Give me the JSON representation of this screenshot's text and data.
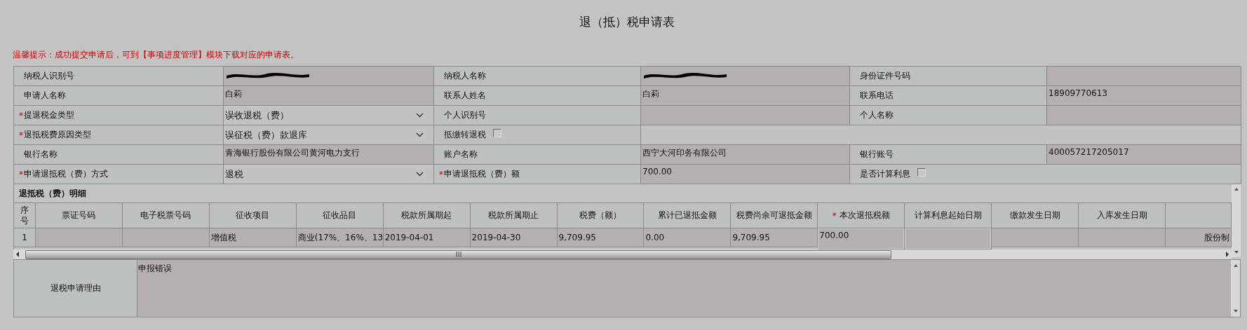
{
  "title": "退（抵）税申请表",
  "notice": "温馨提示：成功提交申请后，可到【事项进度管理】模块下载对应的申请表。",
  "form_rows": [
    [
      {
        "kind": "label",
        "text": "纳税人识别号"
      },
      {
        "kind": "value",
        "redacted": true
      },
      {
        "kind": "label",
        "text": "纳税人名称"
      },
      {
        "kind": "value",
        "redacted": true
      },
      {
        "kind": "label",
        "text": "身份证件号码"
      },
      {
        "kind": "value"
      }
    ],
    [
      {
        "kind": "label",
        "text": "申请人名称"
      },
      {
        "kind": "value",
        "text": "白莉"
      },
      {
        "kind": "label",
        "text": "联系人姓名"
      },
      {
        "kind": "value",
        "text": "白莉"
      },
      {
        "kind": "label",
        "text": "联系电话"
      },
      {
        "kind": "value",
        "text": "18909770613"
      }
    ],
    [
      {
        "kind": "label",
        "text": "提退税金类型",
        "mark": "*"
      },
      {
        "kind": "select",
        "text": "误收退税（费）"
      },
      {
        "kind": "label",
        "text": "个人识别号"
      },
      {
        "kind": "value"
      },
      {
        "kind": "label",
        "text": "个人名称"
      },
      {
        "kind": "value"
      }
    ],
    [
      {
        "kind": "label",
        "text": "退抵税费原因类型",
        "mark": "*"
      },
      {
        "kind": "select",
        "text": "误征税（费）款退库"
      },
      {
        "kind": "checkbox",
        "text": "抵缴转退税",
        "checked": false
      },
      {
        "kind": "blank"
      }
    ],
    [
      {
        "kind": "label",
        "text": "银行名称"
      },
      {
        "kind": "value",
        "text": "青海银行股份有限公司黄河电力支行"
      },
      {
        "kind": "label",
        "text": "账户名称"
      },
      {
        "kind": "value",
        "text": "西宁大河印务有限公司"
      },
      {
        "kind": "label",
        "text": "银行账号"
      },
      {
        "kind": "value",
        "text": "400057217205017"
      }
    ],
    [
      {
        "kind": "label",
        "text": "申请退抵税（费）方式",
        "mark": "*"
      },
      {
        "kind": "select",
        "text": "退税"
      },
      {
        "kind": "label",
        "text": "申请退抵税（费）额",
        "mark": "*"
      },
      {
        "kind": "value",
        "text": "700.00"
      },
      {
        "kind": "checkbox",
        "text": "是否计算利息",
        "checked": false
      }
    ]
  ],
  "detail": {
    "title": "退抵税（费）明细",
    "columns": [
      {
        "label": "序号",
        "kind": "text"
      },
      {
        "label": "票证号码",
        "kind": "text"
      },
      {
        "label": "电子税票号码",
        "kind": "text"
      },
      {
        "label": "征收项目",
        "kind": "text"
      },
      {
        "label": "征收品目",
        "kind": "text"
      },
      {
        "label": "税款所属期起",
        "kind": "text"
      },
      {
        "label": "税款所属期止",
        "kind": "text"
      },
      {
        "label": "税费（额）",
        "kind": "text"
      },
      {
        "label": "累计已退抵金额",
        "kind": "text"
      },
      {
        "label": "税费尚余可退抵金额",
        "kind": "text"
      },
      {
        "label": "本次退抵税额",
        "mark": "*",
        "kind": "input"
      },
      {
        "label": "计算利息起始日期",
        "kind": "input"
      },
      {
        "label": "缴款发生日期",
        "kind": "text"
      },
      {
        "label": "入库发生日期",
        "kind": "text"
      },
      {
        "kind": "text"
      }
    ],
    "rows": [
      [
        "1",
        null,
        null,
        "增值税",
        "商业(17%、16%、13",
        "2019-04-01",
        "2019-04-30",
        "9,709.95",
        "0.00",
        "9,709.95",
        "700.00",
        null,
        null,
        null,
        "股份制"
      ]
    ]
  },
  "reason": {
    "label": "退税申请理由",
    "value": "申报错误"
  }
}
